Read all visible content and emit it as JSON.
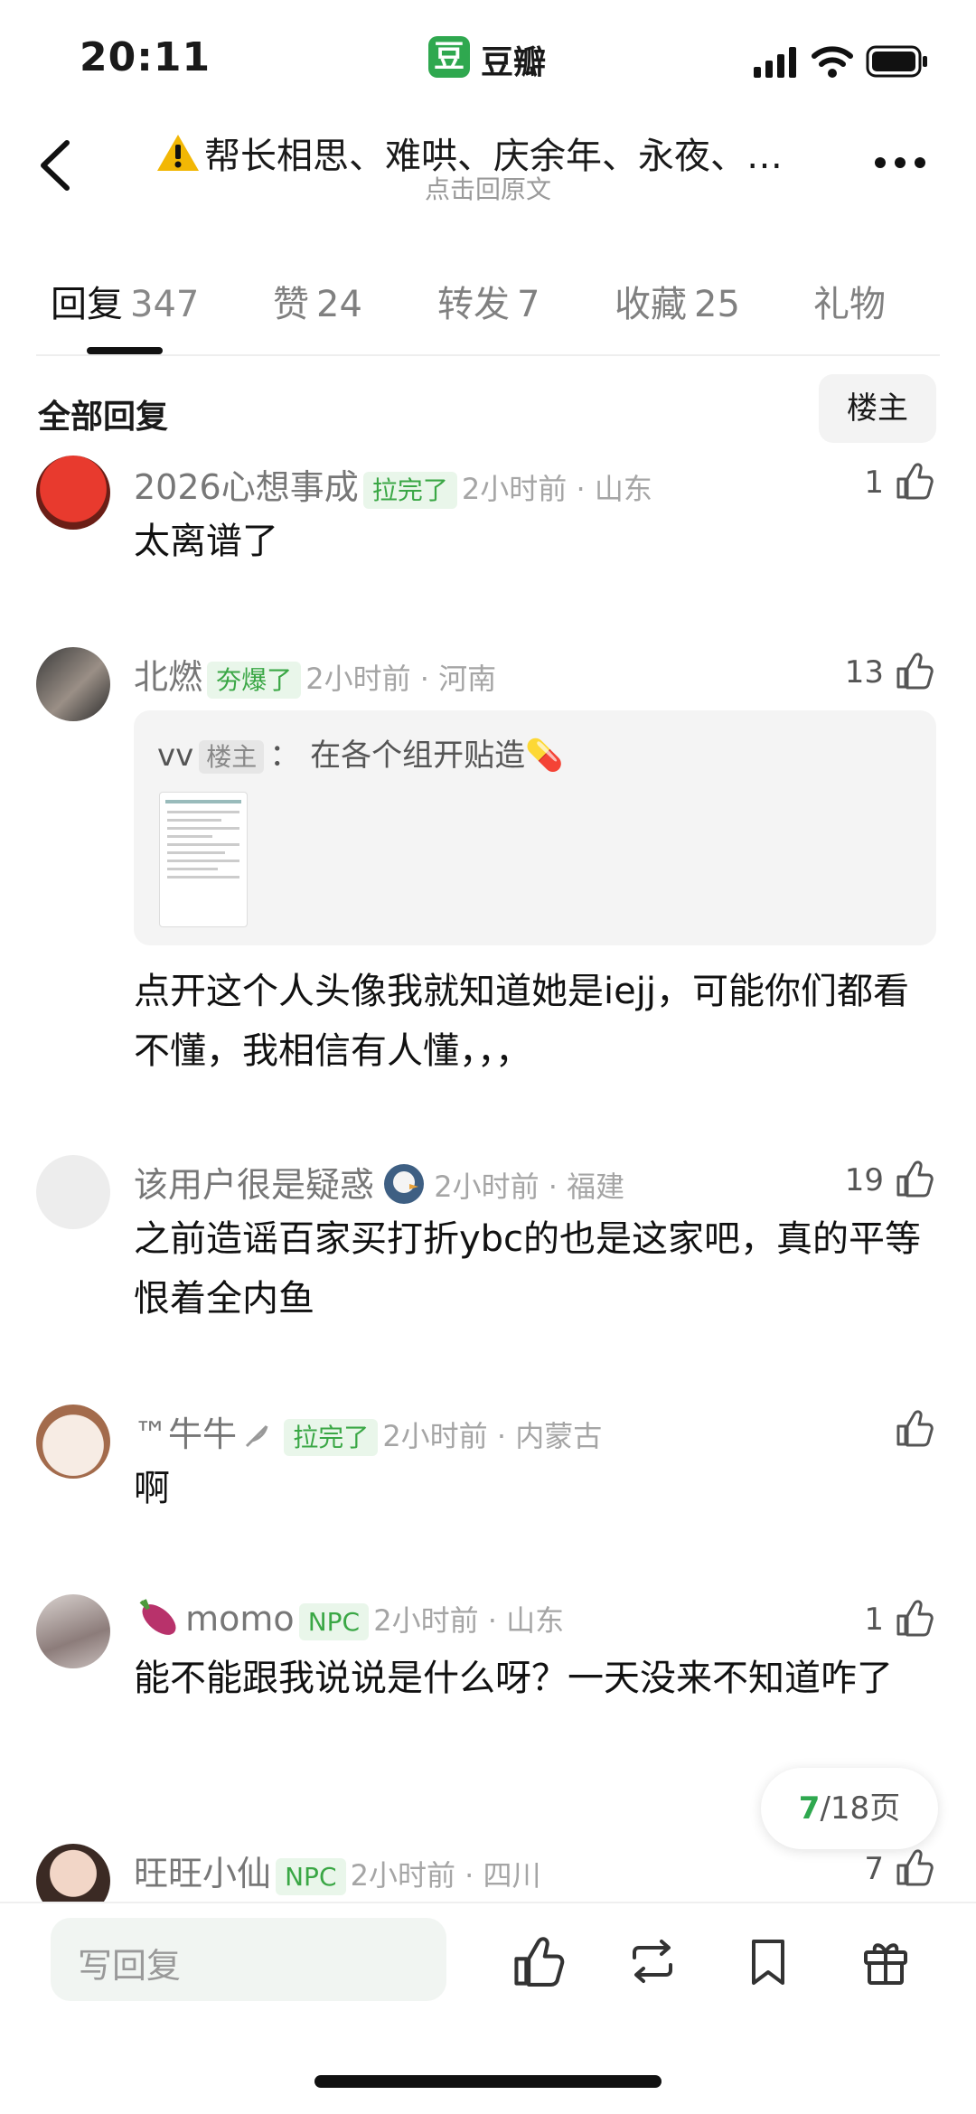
{
  "status_bar": {
    "time": "20:11",
    "app_logo_char": "豆",
    "app_name": "豆瓣"
  },
  "nav": {
    "title": "帮长相思、难哄、庆余年、永夜、…",
    "subtitle": "点击回原文"
  },
  "tabs": [
    {
      "label": "回复",
      "count": "347"
    },
    {
      "label": "赞",
      "count": "24"
    },
    {
      "label": "转发",
      "count": "7"
    },
    {
      "label": "收藏",
      "count": "25"
    },
    {
      "label": "礼物",
      "count": ""
    }
  ],
  "filter": {
    "all_label": "全部回复",
    "op_label": "楼主"
  },
  "comments": [
    {
      "name": "2026心想事成",
      "badge": "拉完了",
      "time": "2小时前",
      "region": "山东",
      "likes": "1",
      "text": "太离谱了"
    },
    {
      "name": "北燃",
      "badge": "夯爆了",
      "time": "2小时前",
      "region": "河南",
      "likes": "13",
      "quote": {
        "user": "vv",
        "tag": "楼主",
        "sep": "：",
        "text": "在各个组开贴造💊"
      },
      "text": "点开这个人头像我就知道她是iejj，可能你们都看不懂，我相信有人懂，，，"
    },
    {
      "name": "该用户很是疑惑",
      "badge": "",
      "time": "2小时前",
      "region": "福建",
      "likes": "19",
      "text": "之前造谣百家买打折ybc的也是这家吧，真的平等恨着全内鱼"
    },
    {
      "name": "™牛牛",
      "badge": "拉完了",
      "time": "2小时前",
      "region": "内蒙古",
      "likes": "",
      "text": "啊"
    },
    {
      "name": "momo",
      "badge": "NPC",
      "time": "2小时前",
      "region": "山东",
      "likes": "1",
      "text": "能不能跟我说说是什么呀？一天没来不知道咋了"
    },
    {
      "name": "旺旺小仙",
      "badge": "NPC",
      "time": "2小时前",
      "region": "四川",
      "likes": "7",
      "text": ""
    }
  ],
  "pagination": {
    "current": "7",
    "total": "/18页"
  },
  "bottom": {
    "reply_placeholder": "写回复"
  },
  "colors": {
    "brand_green": "#2fa84f",
    "badge_green": "#3aa745",
    "warning": "#f2b705"
  },
  "icons": [
    "back-icon",
    "more-icon",
    "like-icon",
    "repost-icon",
    "bookmark-icon",
    "gift-icon",
    "warning-icon"
  ]
}
